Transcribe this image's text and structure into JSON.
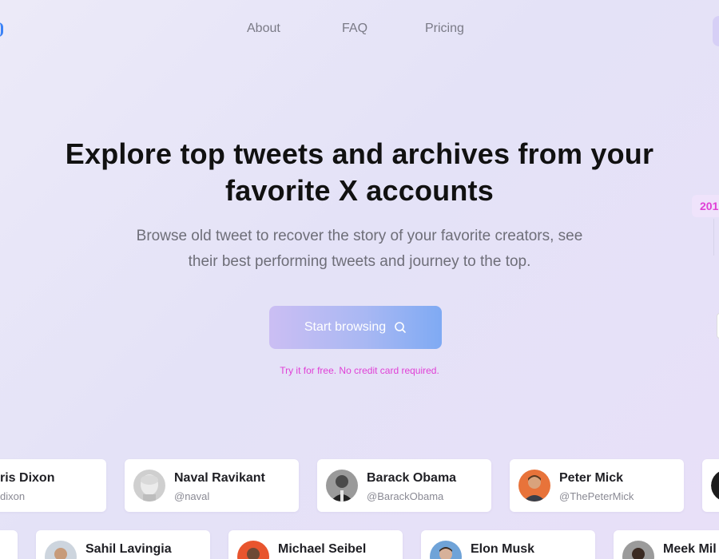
{
  "nav": {
    "links": [
      "About",
      "FAQ",
      "Pricing"
    ]
  },
  "hero": {
    "title_line1": "Explore top tweets and archives from your",
    "title_line2": "favorite X accounts",
    "subtitle_line1": "Browse old tweet to recover the story of your favorite creators, see",
    "subtitle_line2": "their best performing tweets and journey to the top.",
    "cta_label": "Start browsing",
    "free_note": "Try it for free. No credit card required."
  },
  "side_timeline": {
    "year_fragment": "201"
  },
  "accounts_row1": [
    {
      "name": "ris Dixon",
      "handle": "dixon",
      "avatar": "none"
    },
    {
      "name": "Naval Ravikant",
      "handle": "@naval",
      "avatar": "statue-avatar"
    },
    {
      "name": "Barack Obama",
      "handle": "@BarackObama",
      "avatar": "grayscale-portrait-avatar"
    },
    {
      "name": "Peter Mick",
      "handle": "@ThePeterMick",
      "avatar": "orange-portrait-avatar"
    },
    {
      "name": "",
      "handle": "",
      "avatar": "dark-avatar"
    }
  ],
  "accounts_row2": [
    {
      "name": "Sahil Lavingia",
      "handle": "",
      "avatar": "portrait-avatar"
    },
    {
      "name": "Michael Seibel",
      "handle": "",
      "avatar": "orange-portrait-avatar"
    },
    {
      "name": "Elon Musk",
      "handle": "",
      "avatar": "blue-portrait-avatar"
    },
    {
      "name": "Meek Mil",
      "handle": "",
      "avatar": "dark-portrait-avatar"
    }
  ],
  "colors": {
    "accent_pink": "#e040d6",
    "cta_gradient_start": "#cbbef3",
    "cta_gradient_end": "#7faaf3",
    "background": "#e6e4f7"
  }
}
